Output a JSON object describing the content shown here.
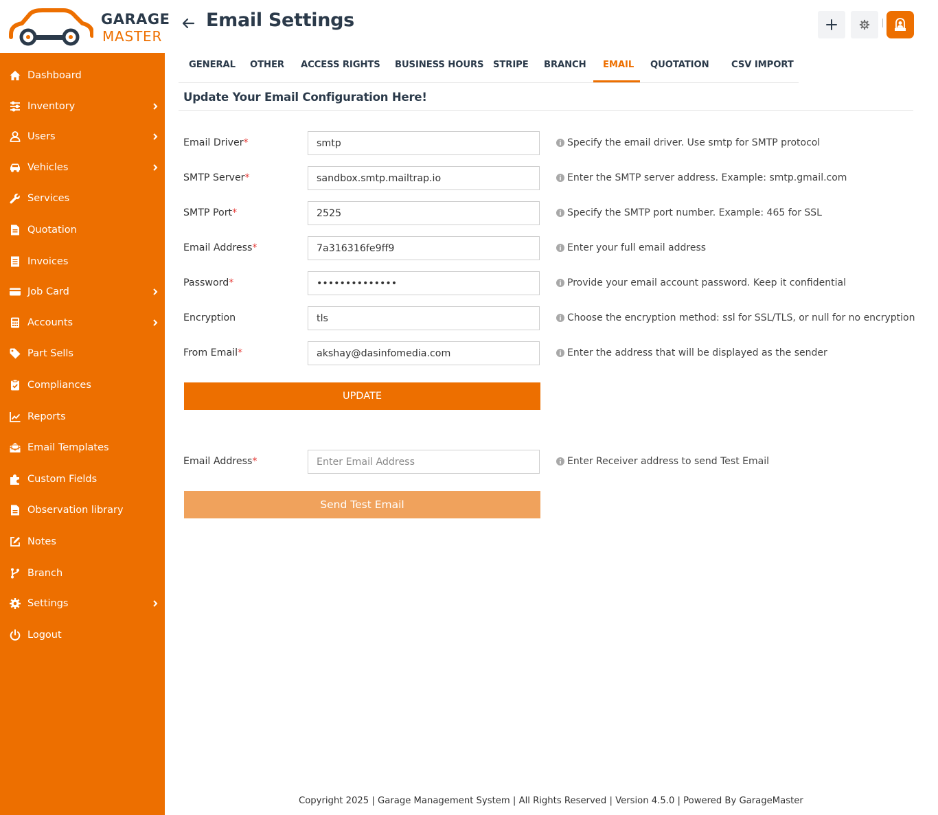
{
  "brand": {
    "line1": "GARAGE",
    "line2": "MASTER",
    "accent": "#ed6f00",
    "dark": "#2b3a4a"
  },
  "sidebar": {
    "items": [
      {
        "label": "Dashboard",
        "icon": "home-icon",
        "has_submenu": false
      },
      {
        "label": "Inventory",
        "icon": "sliders-icon",
        "has_submenu": true
      },
      {
        "label": "Users",
        "icon": "user-icon",
        "has_submenu": true
      },
      {
        "label": "Vehicles",
        "icon": "car-icon",
        "has_submenu": true
      },
      {
        "label": "Services",
        "icon": "wrench-icon",
        "has_submenu": false
      },
      {
        "label": "Quotation",
        "icon": "file-invoice-icon",
        "has_submenu": false
      },
      {
        "label": "Invoices",
        "icon": "file-lines-icon",
        "has_submenu": false
      },
      {
        "label": "Job Card",
        "icon": "credit-card-icon",
        "has_submenu": true
      },
      {
        "label": "Accounts",
        "icon": "calculator-icon",
        "has_submenu": true
      },
      {
        "label": "Part Sells",
        "icon": "tag-icon",
        "has_submenu": false
      },
      {
        "label": "Compliances",
        "icon": "clipboard-check-icon",
        "has_submenu": false
      },
      {
        "label": "Reports",
        "icon": "chart-line-icon",
        "has_submenu": false
      },
      {
        "label": "Email Templates",
        "icon": "envelope-open-icon",
        "has_submenu": false
      },
      {
        "label": "Custom Fields",
        "icon": "puzzle-icon",
        "has_submenu": false
      },
      {
        "label": "Observation library",
        "icon": "file-icon",
        "has_submenu": false
      },
      {
        "label": "Notes",
        "icon": "edit-icon",
        "has_submenu": false
      },
      {
        "label": "Branch",
        "icon": "code-branch-icon",
        "has_submenu": false
      },
      {
        "label": "Settings",
        "icon": "gear-icon",
        "has_submenu": true
      },
      {
        "label": "Logout",
        "icon": "power-icon",
        "has_submenu": false
      }
    ]
  },
  "header": {
    "title": "Email Settings"
  },
  "tabs": [
    {
      "label": "GENERAL",
      "active": false
    },
    {
      "label": "OTHER",
      "active": false
    },
    {
      "label": "ACCESS RIGHTS",
      "active": false
    },
    {
      "label": "BUSINESS HOURS",
      "active": false
    },
    {
      "label": "STRIPE",
      "active": false
    },
    {
      "label": "BRANCH",
      "active": false
    },
    {
      "label": "EMAIL",
      "active": true
    },
    {
      "label": "QUOTATION",
      "active": false
    },
    {
      "label": "CSV IMPORT",
      "active": false
    }
  ],
  "section_title": "Update Your Email Configuration Here!",
  "form": {
    "fields": [
      {
        "label": "Email Driver",
        "required": true,
        "value": "smtp",
        "help": "Specify the email driver. Use smtp for SMTP protocol"
      },
      {
        "label": "SMTP Server",
        "required": true,
        "value": "sandbox.smtp.mailtrap.io",
        "help": "Enter the SMTP server address. Example: smtp.gmail.com"
      },
      {
        "label": "SMTP Port",
        "required": true,
        "value": "2525",
        "help": "Specify the SMTP port number. Example: 465 for SSL"
      },
      {
        "label": "Email Address",
        "required": true,
        "value": "7a316316fe9ff9",
        "help": "Enter your full email address"
      },
      {
        "label": "Password",
        "required": true,
        "value": "••••••••••••••",
        "help": "Provide your email account password. Keep it confidential"
      },
      {
        "label": "Encryption",
        "required": false,
        "value": "tls",
        "help": "Choose the encryption method: ssl for SSL/TLS, or null for no encryption"
      },
      {
        "label": "From Email",
        "required": true,
        "value": "akshay@dasinfomedia.com",
        "help": "Enter the address that will be displayed as the sender"
      }
    ],
    "update_label": "UPDATE"
  },
  "test_email": {
    "label": "Email Address",
    "required_mark": "*",
    "placeholder": "Enter Email Address",
    "help": "Enter Receiver address to send Test Email",
    "button_label": "Send Test Email"
  },
  "footer": "Copyright 2025 | Garage Management System | All Rights Reserved | Version 4.5.0 | Powered By GarageMaster"
}
